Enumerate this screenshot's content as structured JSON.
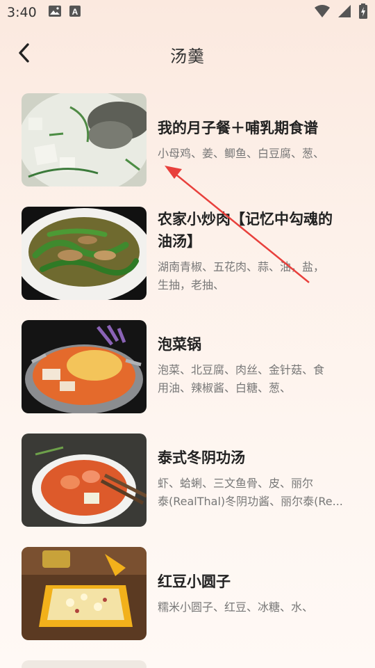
{
  "status_bar": {
    "time": "3:40",
    "icons": [
      "image-icon",
      "font-a-icon",
      "wifi-icon",
      "signal-icon",
      "battery-charging-icon"
    ]
  },
  "header": {
    "title": "汤羹",
    "back_icon": "chevron-left-icon"
  },
  "recipes": [
    {
      "title_lines": [
        "我的月子餐＋哺乳期食谱"
      ],
      "desc_lines": [
        "小母鸡、姜、鲫鱼、白豆腐、葱、"
      ]
    },
    {
      "title_lines": [
        "农家小炒肉【记忆中勾魂的",
        "油汤】"
      ],
      "desc_lines": [
        "湖南青椒、五花肉、蒜、油，盐，",
        "生抽，老抽、"
      ]
    },
    {
      "title_lines": [
        "泡菜锅"
      ],
      "desc_lines": [
        "泡菜、北豆腐、肉丝、金针菇、食",
        "用油、辣椒酱、白糖、葱、"
      ]
    },
    {
      "title_lines": [
        "泰式冬阴功汤"
      ],
      "desc_lines": [
        "虾、蛤蜊、三文鱼骨、皮、丽尔",
        "泰(RealThal)冬阴功酱、丽尔泰(Re..."
      ]
    },
    {
      "title_lines": [
        "红豆小圆子"
      ],
      "desc_lines": [
        "糯米小圆子、红豆、冰糖、水、"
      ]
    }
  ],
  "colors": {
    "annotation_arrow": "#e8403c",
    "title_text": "#222222",
    "desc_text": "#777777"
  }
}
